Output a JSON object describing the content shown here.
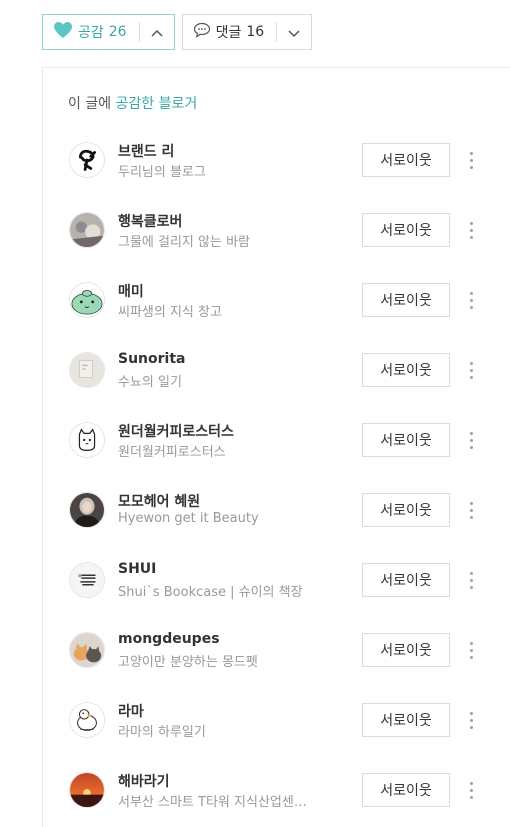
{
  "toolbar": {
    "like_label": "공감",
    "like_count": "26",
    "comment_label": "댓글",
    "comment_count": "16"
  },
  "panel": {
    "title_prefix": "이 글에 ",
    "title_accent": "공감한 블로거"
  },
  "bloggers": [
    {
      "name": "브랜드 리",
      "desc": "두리님의 블로그",
      "button": "서로이웃"
    },
    {
      "name": "행복클로버",
      "desc": "그물에 걸리지 않는 바람",
      "button": "서로이웃"
    },
    {
      "name": "매미",
      "desc": "씨파생의 지식 창고",
      "button": "서로이웃"
    },
    {
      "name": "Sunorita",
      "desc": "수뇨의 일기",
      "button": "서로이웃"
    },
    {
      "name": "원더월커피로스터스",
      "desc": "원더월커피로스터스",
      "button": "서로이웃"
    },
    {
      "name": "모모헤어 혜원",
      "desc": "Hyewon get it Beauty",
      "button": "서로이웃"
    },
    {
      "name": "SHUI",
      "desc": "Shui`s Bookcase | 슈이의 책장",
      "button": "서로이웃"
    },
    {
      "name": "mongdeupes",
      "desc": "고양이만 분양하는 몽드펫",
      "button": "서로이웃"
    },
    {
      "name": "라마",
      "desc": "라마의 하루일기",
      "button": "서로이웃"
    },
    {
      "name": "해바라기",
      "desc": "서부산 스마트 T타워 지식산업센…",
      "button": "서로이웃"
    }
  ],
  "colors": {
    "accent": "#39a7a7",
    "heart": "#5cc5c5"
  }
}
